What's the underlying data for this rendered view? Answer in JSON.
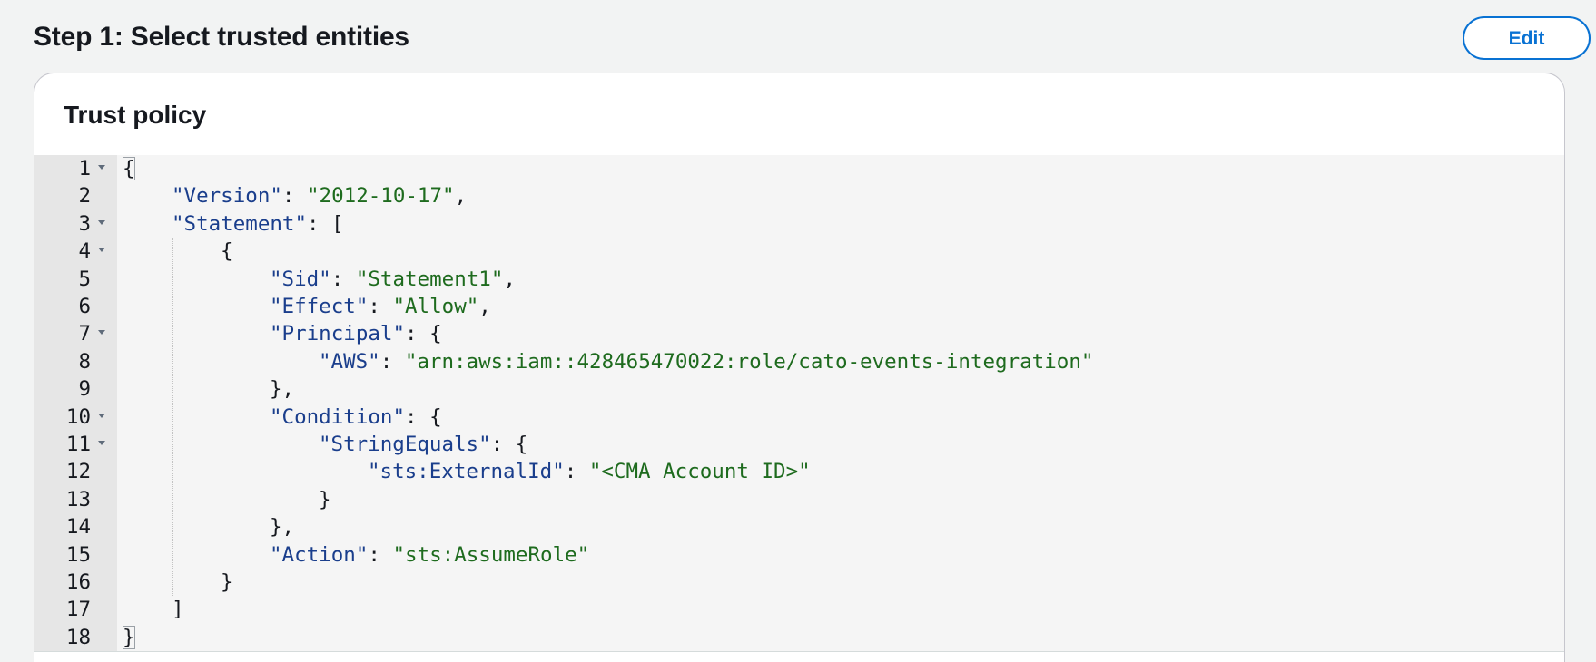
{
  "step": {
    "title": "Step 1: Select trusted entities",
    "edit_label": "Edit"
  },
  "card": {
    "title": "Trust policy"
  },
  "editor": {
    "lines": [
      {
        "n": "1",
        "fold": true,
        "indent": 0,
        "parts": [
          {
            "t": "{",
            "c": "p",
            "hl": true
          }
        ]
      },
      {
        "n": "2",
        "fold": false,
        "indent": 1,
        "parts": [
          {
            "t": "\"Version\"",
            "c": "key"
          },
          {
            "t": ": ",
            "c": "p"
          },
          {
            "t": "\"2012-10-17\"",
            "c": "str"
          },
          {
            "t": ",",
            "c": "p"
          }
        ]
      },
      {
        "n": "3",
        "fold": true,
        "indent": 1,
        "parts": [
          {
            "t": "\"Statement\"",
            "c": "key"
          },
          {
            "t": ": [",
            "c": "p"
          }
        ]
      },
      {
        "n": "4",
        "fold": true,
        "indent": 2,
        "parts": [
          {
            "t": "{",
            "c": "p"
          }
        ]
      },
      {
        "n": "5",
        "fold": false,
        "indent": 3,
        "parts": [
          {
            "t": "\"Sid\"",
            "c": "key"
          },
          {
            "t": ": ",
            "c": "p"
          },
          {
            "t": "\"Statement1\"",
            "c": "str"
          },
          {
            "t": ",",
            "c": "p"
          }
        ]
      },
      {
        "n": "6",
        "fold": false,
        "indent": 3,
        "parts": [
          {
            "t": "\"Effect\"",
            "c": "key"
          },
          {
            "t": ": ",
            "c": "p"
          },
          {
            "t": "\"Allow\"",
            "c": "str"
          },
          {
            "t": ",",
            "c": "p"
          }
        ]
      },
      {
        "n": "7",
        "fold": true,
        "indent": 3,
        "parts": [
          {
            "t": "\"Principal\"",
            "c": "key"
          },
          {
            "t": ": {",
            "c": "p"
          }
        ]
      },
      {
        "n": "8",
        "fold": false,
        "indent": 4,
        "parts": [
          {
            "t": "\"AWS\"",
            "c": "key"
          },
          {
            "t": ": ",
            "c": "p"
          },
          {
            "t": "\"arn:aws:iam::428465470022:role/cato-events-integration\"",
            "c": "str"
          }
        ]
      },
      {
        "n": "9",
        "fold": false,
        "indent": 3,
        "parts": [
          {
            "t": "},",
            "c": "p"
          }
        ]
      },
      {
        "n": "10",
        "fold": true,
        "indent": 3,
        "parts": [
          {
            "t": "\"Condition\"",
            "c": "key"
          },
          {
            "t": ": {",
            "c": "p"
          }
        ]
      },
      {
        "n": "11",
        "fold": true,
        "indent": 4,
        "parts": [
          {
            "t": "\"StringEquals\"",
            "c": "key"
          },
          {
            "t": ": {",
            "c": "p"
          }
        ]
      },
      {
        "n": "12",
        "fold": false,
        "indent": 5,
        "parts": [
          {
            "t": "\"sts:ExternalId\"",
            "c": "key"
          },
          {
            "t": ": ",
            "c": "p"
          },
          {
            "t": "\"<CMA Account ID>\"",
            "c": "str"
          }
        ]
      },
      {
        "n": "13",
        "fold": false,
        "indent": 4,
        "parts": [
          {
            "t": "}",
            "c": "p"
          }
        ]
      },
      {
        "n": "14",
        "fold": false,
        "indent": 3,
        "parts": [
          {
            "t": "},",
            "c": "p"
          }
        ]
      },
      {
        "n": "15",
        "fold": false,
        "indent": 3,
        "parts": [
          {
            "t": "\"Action\"",
            "c": "key"
          },
          {
            "t": ": ",
            "c": "p"
          },
          {
            "t": "\"sts:AssumeRole\"",
            "c": "str"
          }
        ]
      },
      {
        "n": "16",
        "fold": false,
        "indent": 2,
        "parts": [
          {
            "t": "}",
            "c": "p"
          }
        ]
      },
      {
        "n": "17",
        "fold": false,
        "indent": 1,
        "parts": [
          {
            "t": "]",
            "c": "p"
          }
        ]
      },
      {
        "n": "18",
        "fold": false,
        "indent": 0,
        "parts": [
          {
            "t": "}",
            "c": "p",
            "hl": true
          }
        ]
      }
    ]
  }
}
